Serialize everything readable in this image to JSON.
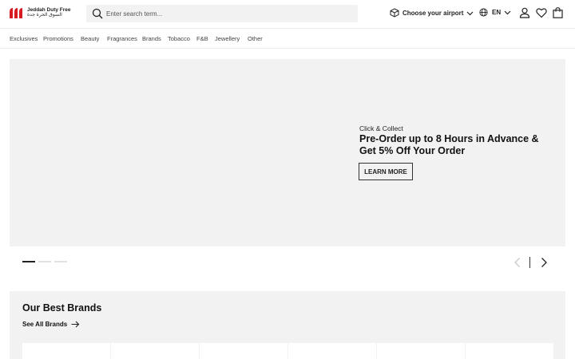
{
  "header": {
    "logo_en": "Jeddah Duty Free",
    "logo_ar": "السوق الحرة جدة",
    "search_placeholder": "Enter search term...",
    "airport_label": "Choose your airport",
    "language": "EN",
    "brand_color": "#d71920"
  },
  "nav": {
    "items": [
      "Exclusives",
      "Promotions",
      "Beauty",
      "Fragrances",
      "Brands",
      "Tobacco",
      "F&B",
      "Jewellery",
      "Other"
    ]
  },
  "hero": {
    "eyebrow": "Click & Collect",
    "title": "Pre-Order up to 8 Hours in Advance & Get 5% Off Your Order",
    "cta": "LEARN MORE",
    "slides_total": 3,
    "active_slide": 1
  },
  "brands": {
    "title": "Our Best Brands",
    "see_all": "See All Brands"
  }
}
